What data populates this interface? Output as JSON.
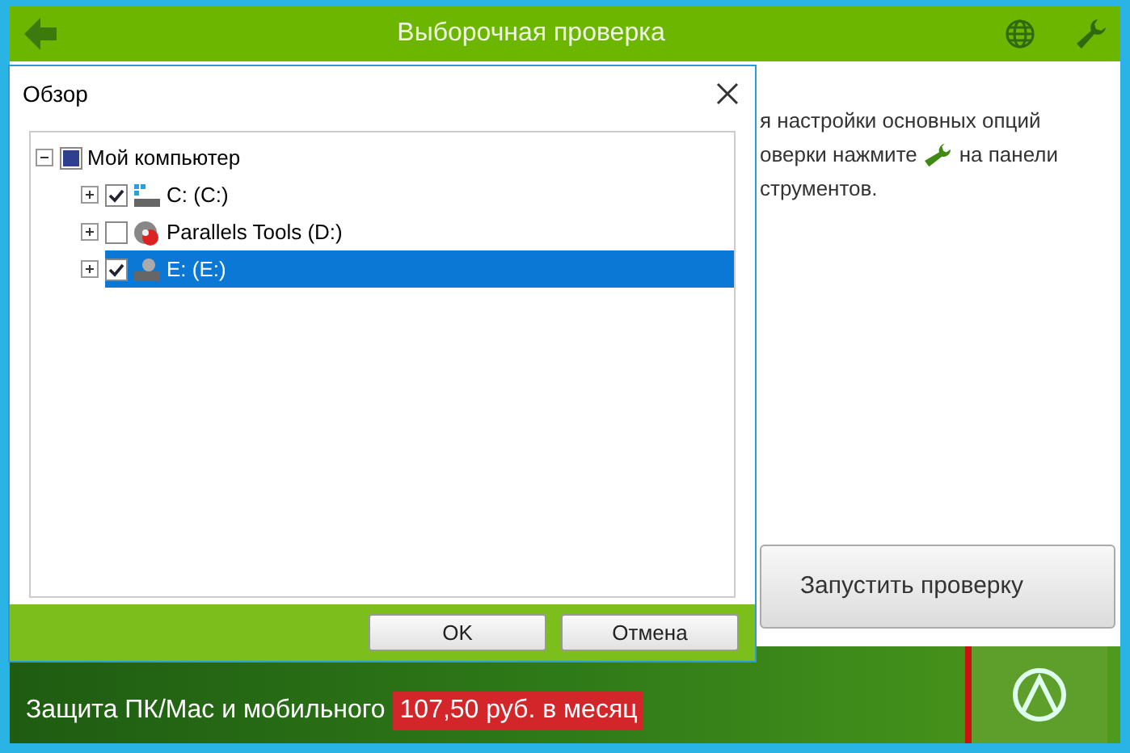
{
  "app": {
    "title": "Выборочная проверка"
  },
  "info": {
    "lines": [
      "я настройки основных опций",
      "оверки нажмите",
      "на панели",
      "струментов."
    ]
  },
  "run_button": "Запустить проверку",
  "banner": {
    "text": "Защита ПК/Mac и мобильного",
    "price": "107,50 руб. в месяц"
  },
  "dialog": {
    "title": "Обзор",
    "tree": [
      {
        "label": "Мой компьютер",
        "checked": false,
        "partial": true,
        "expanded": true,
        "selected": false,
        "children": [
          {
            "label": "C: (C:)",
            "checked": true,
            "partial": false,
            "expanded": false,
            "selected": false,
            "kind": "drive"
          },
          {
            "label": "Parallels Tools (D:)",
            "checked": false,
            "partial": false,
            "expanded": false,
            "selected": false,
            "kind": "disc"
          },
          {
            "label": "E: (E:)",
            "checked": true,
            "partial": false,
            "expanded": false,
            "selected": true,
            "kind": "network"
          }
        ]
      }
    ],
    "buttons": [
      "OK",
      "Отмена"
    ]
  }
}
